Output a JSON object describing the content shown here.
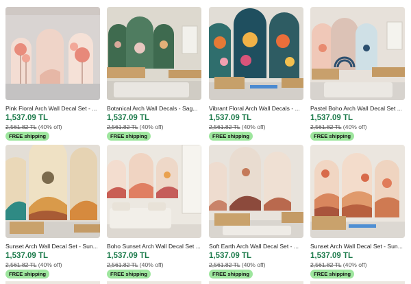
{
  "listings": [
    {
      "title": "Pink Floral Arch Wall Decal Set - ...",
      "price": "1,537.09 TL",
      "original_price": "2,561.82 TL",
      "discount": "(40% off)",
      "shipping": "FREE shipping",
      "theme": "pink-floral-arch"
    },
    {
      "title": "Botanical Arch Wall Decals - Sag...",
      "price": "1,537.09 TL",
      "original_price": "2,561.82 TL",
      "discount": "(40% off)",
      "shipping": "FREE shipping",
      "theme": "botanical-arch"
    },
    {
      "title": "Vibrant Floral Arch Wall Decals - ...",
      "price": "1,537.09 TL",
      "original_price": "2,561.82 TL",
      "discount": "(40% off)",
      "shipping": "FREE shipping",
      "theme": "vibrant-floral-arch"
    },
    {
      "title": "Pastel Boho Arch Wall Decal Set ...",
      "price": "1,537.09 TL",
      "original_price": "2,561.82 TL",
      "discount": "(40% off)",
      "shipping": "FREE shipping",
      "theme": "pastel-boho-arch"
    },
    {
      "title": "Sunset Arch Wall Decal Set - Sun...",
      "price": "1,537.09 TL",
      "original_price": "2,561.82 TL",
      "discount": "(40% off)",
      "shipping": "FREE shipping",
      "theme": "sunset-arch"
    },
    {
      "title": "Boho Sunset Arch Wall Decal Set ...",
      "price": "1,537.09 TL",
      "original_price": "2,561.82 TL",
      "discount": "(40% off)",
      "shipping": "FREE shipping",
      "theme": "boho-sunset-arch"
    },
    {
      "title": "Soft Earth Arch Wall Decal Set - ...",
      "price": "1,537.09 TL",
      "original_price": "2,561.82 TL",
      "discount": "(40% off)",
      "shipping": "FREE shipping",
      "theme": "soft-earth-arch"
    },
    {
      "title": "Sunset Arch Wall Decal Set - Sun...",
      "price": "1,537.09 TL",
      "original_price": "2,561.82 TL",
      "discount": "(40% off)",
      "shipping": "FREE shipping",
      "theme": "sunset-arch-2"
    }
  ],
  "colors": {
    "price_green": "#1b7a4a",
    "badge_green": "#9ee69e"
  }
}
